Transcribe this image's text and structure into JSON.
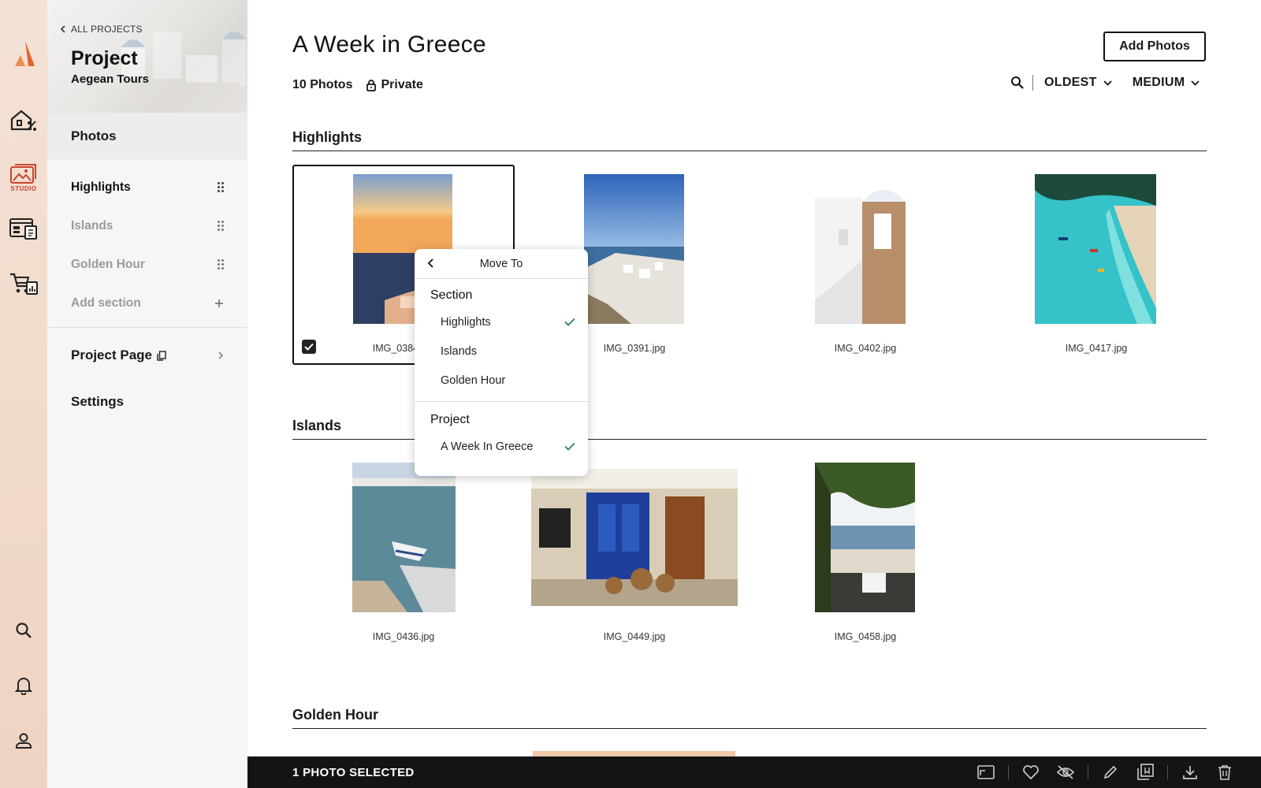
{
  "rail": {
    "studio_label": "STUDIO",
    "accent": "#d85c2a",
    "studio_color": "#c9452f"
  },
  "sidebar": {
    "back_label": "ALL PROJECTS",
    "project_label": "Project",
    "project_name": "Aegean Tours",
    "photos_label": "Photos",
    "sections": [
      {
        "label": "Highlights"
      },
      {
        "label": "Islands"
      },
      {
        "label": "Golden Hour"
      }
    ],
    "add_section_label": "Add section",
    "project_page_label": "Project Page",
    "settings_label": "Settings"
  },
  "header": {
    "title": "A Week in Greece",
    "photo_count": "10 Photos",
    "privacy": "Private",
    "add_photos_label": "Add Photos",
    "sort_label": "OLDEST",
    "size_label": "MEDIUM"
  },
  "sections": [
    {
      "title": "Highlights",
      "photos": [
        {
          "filename": "IMG_0384.jpg",
          "selected": true
        },
        {
          "filename": "IMG_0391.jpg",
          "selected": false
        },
        {
          "filename": "IMG_0402.jpg",
          "selected": false
        },
        {
          "filename": "IMG_0417.jpg",
          "selected": false
        }
      ]
    },
    {
      "title": "Islands",
      "photos": [
        {
          "filename": "IMG_0436.jpg"
        },
        {
          "filename": "IMG_0449.jpg"
        },
        {
          "filename": "IMG_0458.jpg"
        }
      ]
    },
    {
      "title": "Golden Hour",
      "photos": []
    }
  ],
  "move_menu": {
    "title": "Move To",
    "section_group": "Section",
    "section_options": [
      {
        "label": "Highlights",
        "checked": true
      },
      {
        "label": "Islands",
        "checked": false
      },
      {
        "label": "Golden Hour",
        "checked": false
      }
    ],
    "project_group": "Project",
    "project_options": [
      {
        "label": "A Week In Greece",
        "checked": true
      }
    ],
    "check_color": "#2a7d6b"
  },
  "bottom_bar": {
    "selected_label": "1 PHOTO SELECTED"
  }
}
